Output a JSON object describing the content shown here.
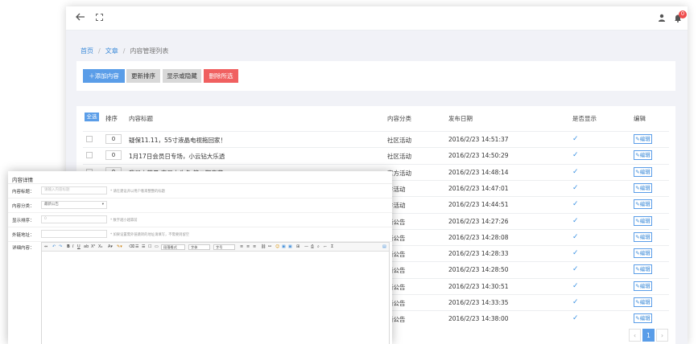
{
  "header": {
    "back_icon": "arrow-left-icon",
    "fullscreen_icon": "fullscreen-icon",
    "user_icon": "user-icon",
    "bell_icon": "bell-icon",
    "notification_count": "0"
  },
  "breadcrumb": [
    "首页",
    "文章",
    "内容管理列表"
  ],
  "toolbar": {
    "add_label": "＋添加内容",
    "sort_label": "更新排序",
    "toggle_label": "显示或隐藏",
    "delete_label": "删除所选"
  },
  "table": {
    "select_all_label": "全选",
    "columns": [
      "排序",
      "内容标题",
      "内容分类",
      "发布日期",
      "是否显示",
      "编辑"
    ],
    "edit_label": "✎编辑",
    "rows": [
      {
        "sort": "0",
        "title": "疑保11.11，55寸液晶电视拖回家！",
        "category": "社区活动",
        "date": "2016/2/23 14:51:37",
        "shown": "✓"
      },
      {
        "sort": "0",
        "title": "1月17日会员日专场，小云钻大乐透",
        "category": "社区活动",
        "date": "2016/2/23 14:50:29",
        "shown": "✓"
      },
      {
        "sort": "0",
        "title": "我是小萌量 宝贝上头条 第二期来袭",
        "category": "官方活动",
        "date": "2016/2/23 14:48:14",
        "shown": "✓"
      },
      {
        "sort": "",
        "title": "",
        "category": "方活动",
        "date": "2016/2/23 14:47:01",
        "shown": "✓"
      },
      {
        "sort": "",
        "title": "",
        "category": "方活动",
        "date": "2016/2/23 14:44:51",
        "shown": "✓"
      },
      {
        "sort": "",
        "title": "",
        "category": "新公告",
        "date": "2016/2/23 14:27:26",
        "shown": "✓"
      },
      {
        "sort": "",
        "title": "",
        "category": "新公告",
        "date": "2016/2/23 14:28:08",
        "shown": "✓"
      },
      {
        "sort": "",
        "title": "",
        "category": "新公告",
        "date": "2016/2/23 14:28:33",
        "shown": "✓"
      },
      {
        "sort": "",
        "title": "",
        "category": "新公告",
        "date": "2016/2/23 14:28:50",
        "shown": "✓"
      },
      {
        "sort": "",
        "title": "",
        "category": "新公告",
        "date": "2016/2/23 14:30:51",
        "shown": "✓"
      },
      {
        "sort": "",
        "title": "",
        "category": "新公告",
        "date": "2016/2/23 14:33:35",
        "shown": "✓"
      },
      {
        "sort": "",
        "title": "",
        "category": "新公告",
        "date": "2016/2/23 14:38:00",
        "shown": "✓"
      }
    ]
  },
  "pagination": {
    "prev": "‹",
    "current": "1",
    "next": "›"
  },
  "detail_form": {
    "title": "内容详情",
    "fields": [
      {
        "label": "内容标题：",
        "placeholder": "请输入内容标题",
        "hint": "* 请在建设开以用户看来整整的标题"
      },
      {
        "label": "内容分类：",
        "value": "最新公告",
        "hint": ""
      },
      {
        "label": "显示排序：",
        "placeholder": "0",
        "hint": "* 数字越小越靠前"
      },
      {
        "label": "外链地址：",
        "placeholder": "",
        "hint": "* 如果设置需外链跳转的地址请填写，不需要则留空"
      }
    ],
    "editor_label": "详细内容：",
    "editor_toolbar": {
      "fontformat": "段落格式",
      "fontfamily": "字体",
      "fontsize": "字号"
    }
  },
  "colors": {
    "primary": "#5a9de8",
    "danger": "#f06060",
    "link": "#3c8bd9",
    "background": "#f1f2f7"
  }
}
